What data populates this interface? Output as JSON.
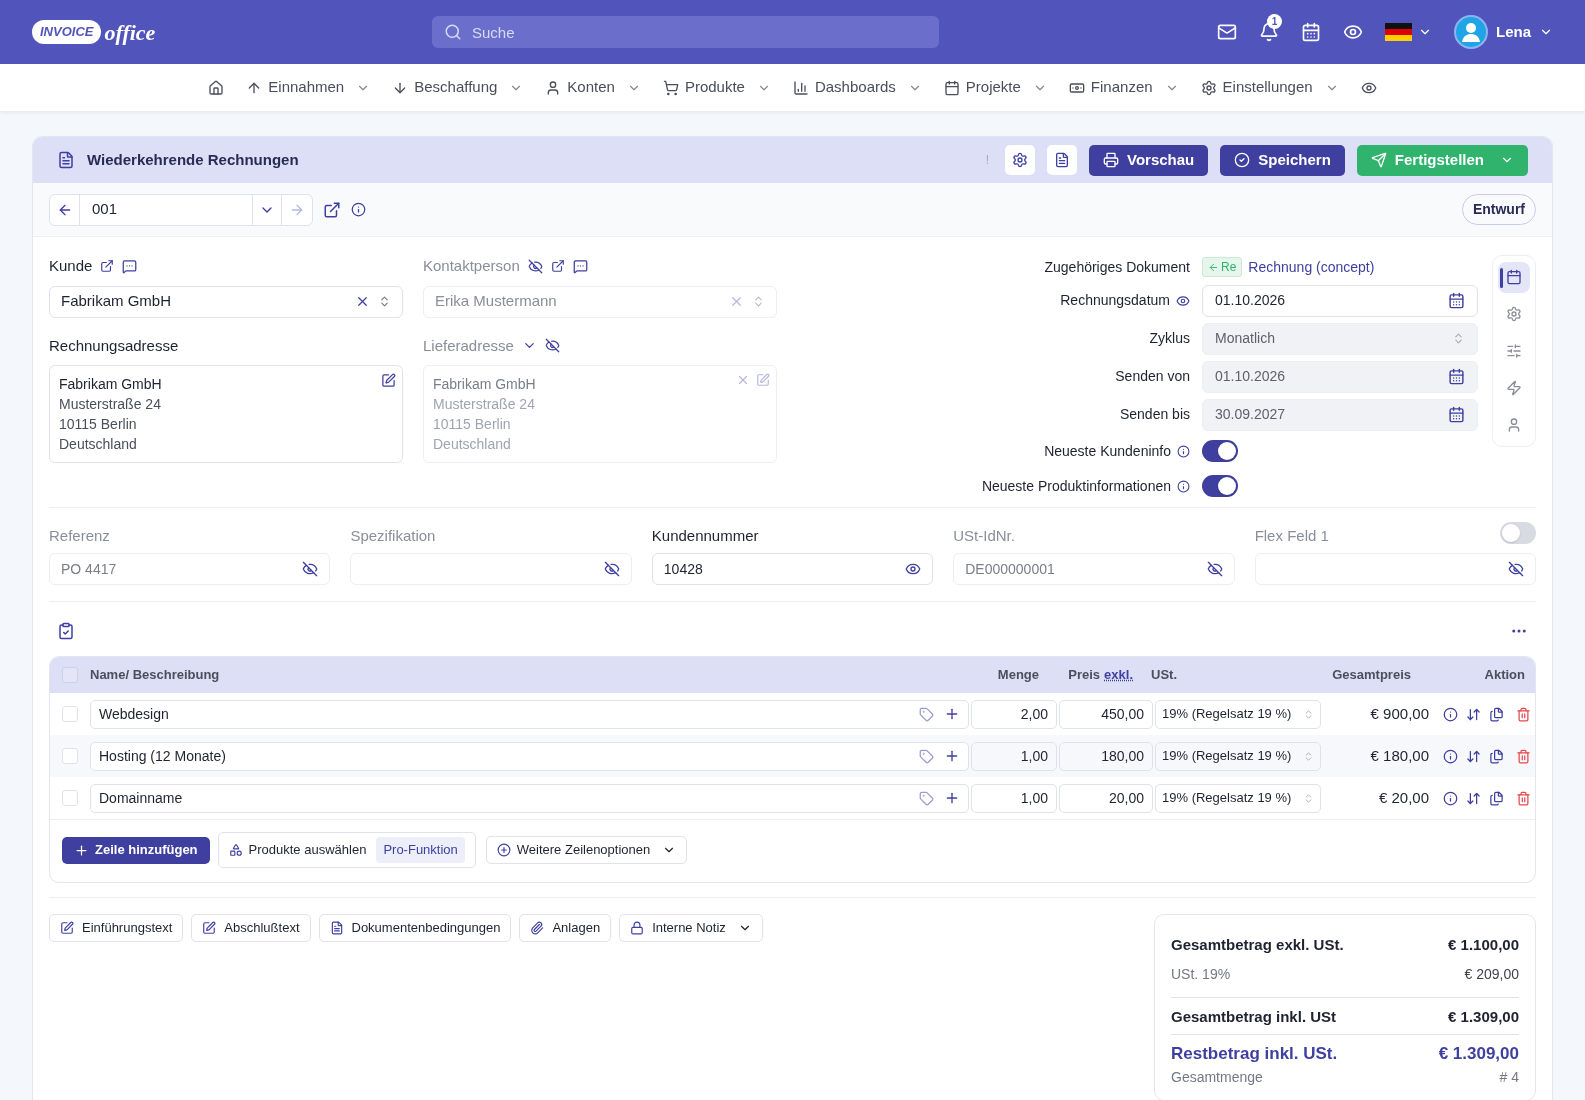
{
  "topbar": {
    "logo": {
      "part1": "INVOICE",
      "part2": "office"
    },
    "search": {
      "placeholder": "Suche"
    },
    "notifications": "1",
    "user": "Lena"
  },
  "nav": [
    "Einnahmen",
    "Beschaffung",
    "Konten",
    "Produkte",
    "Dashboards",
    "Projekte",
    "Finanzen",
    "Einstellungen"
  ],
  "header": {
    "title": "Wiederkehrende Rechnungen",
    "warning": "!",
    "buttons": [
      {
        "label": "Vorschau",
        "kind": "preview"
      },
      {
        "label": "Speichern",
        "kind": "save"
      },
      {
        "label": "Fertigstellen",
        "kind": "finish"
      }
    ]
  },
  "doc_nav": {
    "number": "001",
    "next_disabled": true,
    "status": "Entwurf"
  },
  "customer": {
    "label": "Kunde",
    "value": "Fabrikam GmbH"
  },
  "contact": {
    "label": "Kontaktperson",
    "value": "Erika Mustermann",
    "visible": false
  },
  "billing_address": {
    "label": "Rechnungsadresse",
    "lines": [
      "Fabrikam GmbH",
      "Musterstraße 24",
      "10115 Berlin",
      "Deutschland"
    ]
  },
  "delivery_address": {
    "label": "Lieferadresse",
    "visible": false,
    "lines": [
      "Fabrikam GmbH",
      "Musterstraße 24",
      "10115 Berlin",
      "Deutschland"
    ]
  },
  "related": {
    "label": "Zugehöriges Dokument",
    "tag": "Re",
    "link": "Rechnung (concept)"
  },
  "date_fields": [
    {
      "label": "Rechnungsdatum",
      "value": "01.10.2026",
      "kind": "date",
      "disabled": false
    },
    {
      "label": "Zyklus",
      "value": "Monatlich",
      "kind": "select",
      "disabled": true
    },
    {
      "label": "Senden von",
      "value": "01.10.2026",
      "kind": "date",
      "disabled": true
    },
    {
      "label": "Senden bis",
      "value": "30.09.2027",
      "kind": "date",
      "disabled": true
    }
  ],
  "toggles": [
    {
      "label": "Neueste Kundeninfo",
      "on": true
    },
    {
      "label": "Neueste Produktinformationen",
      "on": true
    }
  ],
  "side_tabs": [
    {
      "selected": true
    },
    {
      "selected": false
    },
    {
      "selected": false
    },
    {
      "selected": false
    },
    {
      "selected": false
    }
  ],
  "extra_fields": [
    {
      "label": "Referenz",
      "value": "PO 4417",
      "visible": false
    },
    {
      "label": "Spezifikation",
      "visible": false
    },
    {
      "label": "Kundennummer",
      "value": "10428",
      "visible": true
    },
    {
      "label": "USt-IdNr.",
      "value": "DE000000001",
      "visible": false
    },
    {
      "label": "Flex Feld 1",
      "visible": false,
      "switch_on": false
    }
  ],
  "table": {
    "all_checked": false,
    "columns": [
      {
        "label": "Name/ Beschreibung"
      },
      {
        "label": "Menge"
      },
      {
        "label": "Preis",
        "note": "exkl."
      },
      {
        "label": "USt."
      },
      {
        "label": "Gesamtpreis"
      },
      {
        "label": "Aktion"
      }
    ],
    "rows": [
      {
        "name": "Webdesign",
        "qty": "2,00",
        "price": "450,00",
        "tax": "19% (Regelsatz 19 %)",
        "total": "€ 900,00",
        "checked": false
      },
      {
        "name": "Hosting (12 Monate)",
        "qty": "1,00",
        "price": "180,00",
        "tax": "19% (Regelsatz 19 %)",
        "total": "€ 180,00",
        "checked": false
      },
      {
        "name": "Domainname",
        "qty": "1,00",
        "price": "20,00",
        "tax": "19% (Regelsatz 19 %)",
        "total": "€ 20,00",
        "checked": false
      }
    ],
    "add_row": "Zeile hinzufügen",
    "select_products": "Produkte auswählen",
    "pro_badge": "Pro-Funktion",
    "more_options": "Weitere Zeilenoptionen"
  },
  "text_buttons": [
    "Einführungstext",
    "Abschlußtext",
    "Dokumentenbedingungen",
    "Anlagen",
    "Interne Notiz"
  ],
  "totals": [
    {
      "label": "Gesamtbetrag exkl. USt.",
      "value": "€ 1.100,00",
      "kind": "strong",
      "divider": false
    },
    {
      "label": "USt. 19%",
      "value": "€ 209,00",
      "kind": "muted",
      "divider": false
    },
    {
      "label": "Gesamtbetrag inkl. USt",
      "value": "€ 1.309,00",
      "kind": "strong",
      "divider": true
    },
    {
      "label": "Restbetrag inkl. USt.",
      "value": "€ 1.309,00",
      "kind": "due",
      "divider": true
    },
    {
      "label": "Gesamtmenge",
      "value": "# 4",
      "kind": "muted",
      "divider": false
    }
  ]
}
